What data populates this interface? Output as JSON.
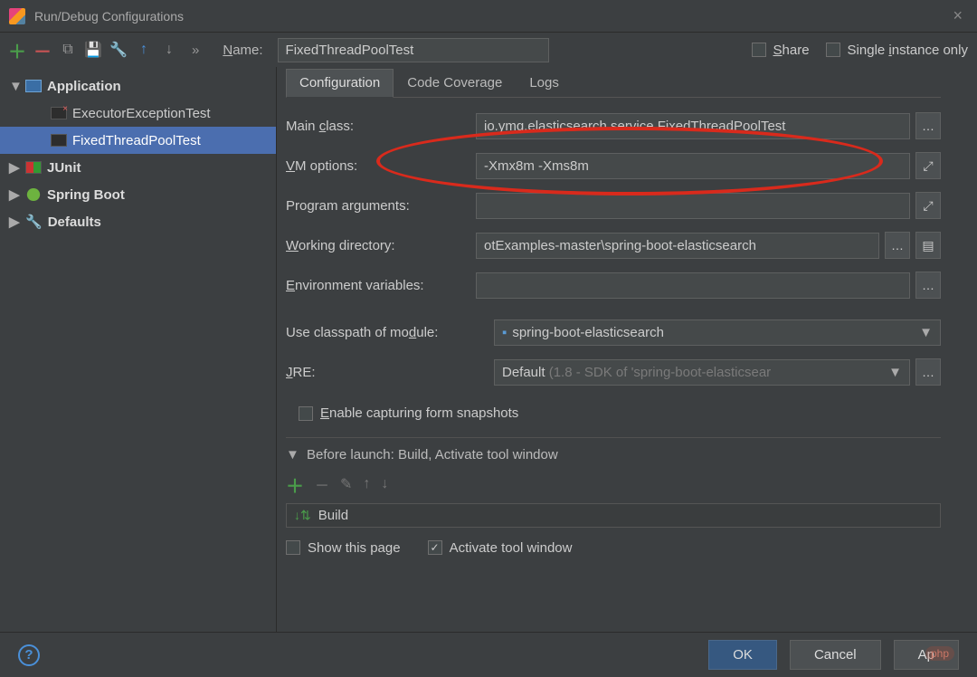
{
  "window": {
    "title": "Run/Debug Configurations"
  },
  "toolbar": {
    "name_label": "Name:",
    "name_value": "FixedThreadPoolTest",
    "share": "Share",
    "single": "Single instance only"
  },
  "tree": {
    "items": [
      {
        "label": "Application",
        "kind": "app",
        "bold": true,
        "expand": "▼"
      },
      {
        "label": "ExecutorExceptionTest",
        "kind": "java-err",
        "child": true
      },
      {
        "label": "FixedThreadPoolTest",
        "kind": "java",
        "child": true,
        "selected": true
      },
      {
        "label": "JUnit",
        "kind": "junit",
        "bold": true,
        "expand": "▶"
      },
      {
        "label": "Spring Boot",
        "kind": "spring",
        "bold": true,
        "expand": "▶"
      },
      {
        "label": "Defaults",
        "kind": "wrench",
        "bold": true,
        "expand": "▶"
      }
    ]
  },
  "tabs": [
    "Configuration",
    "Code Coverage",
    "Logs"
  ],
  "form": {
    "main_class_label": "Main class:",
    "main_class": "io.ymq.elasticsearch.service.FixedThreadPoolTest",
    "vm_label": "VM options:",
    "vm": "-Xmx8m -Xms8m",
    "args_label": "Program arguments:",
    "args": "",
    "wd_label": "Working directory:",
    "wd": "otExamples-master\\spring-boot-elasticsearch",
    "env_label": "Environment variables:",
    "env": "",
    "cp_label": "Use classpath of module:",
    "cp": "spring-boot-elasticsearch",
    "jre_label": "JRE:",
    "jre_default": "Default",
    "jre_detail": " (1.8 - SDK of 'spring-boot-elasticsear",
    "snapshots": "Enable capturing form snapshots"
  },
  "before": {
    "title": "Before launch: Build, Activate tool window",
    "build": "Build",
    "show": "Show this page",
    "activate": "Activate tool window"
  },
  "footer": {
    "ok": "OK",
    "cancel": "Cancel",
    "apply": "Ap",
    "php": "php"
  }
}
